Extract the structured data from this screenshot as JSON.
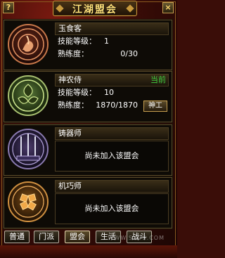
{
  "window": {
    "title": "江湖盟会",
    "help_label": "?",
    "close_label": "×"
  },
  "colors": {
    "gold": "#c89a3e",
    "current_green": "#40d040"
  },
  "guilds": [
    {
      "name": "玉食客",
      "icon": "cauldron-emblem-icon",
      "skill_level_label": "技能等级：",
      "skill_level": "1",
      "proficiency_label": "熟练度：",
      "proficiency": "0/30"
    },
    {
      "name": "神农侍",
      "icon": "herb-emblem-icon",
      "current_tag": "当前",
      "skill_level_label": "技能等级：",
      "skill_level": "10",
      "proficiency_label": "熟练度：",
      "proficiency": "1870/1870",
      "action_label": "神工"
    },
    {
      "name": "铸器师",
      "icon": "weapons-emblem-icon",
      "status": "尚未加入该盟会"
    },
    {
      "name": "机巧师",
      "icon": "gear-emblem-icon",
      "status": "尚未加入该盟会"
    }
  ],
  "tabs": [
    "普通",
    "门派",
    "盟会",
    "生活",
    "战斗"
  ],
  "active_tab": "盟会",
  "watermark": "WWW.SXDS.COM"
}
